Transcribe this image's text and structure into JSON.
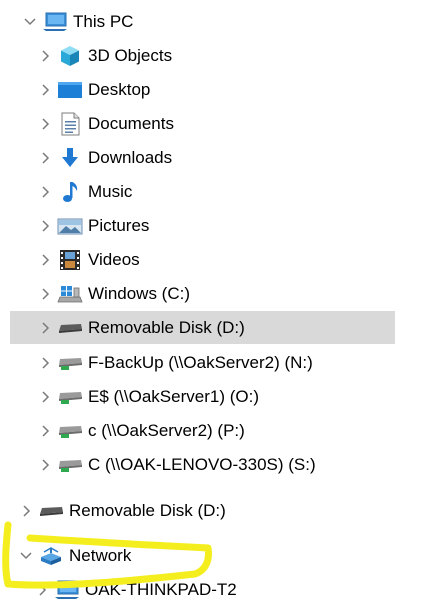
{
  "tree": {
    "this_pc": {
      "label": "This PC",
      "expanded": true,
      "icon": "this-pc-icon",
      "children": [
        {
          "label": "3D Objects",
          "icon": "3d-objects-icon"
        },
        {
          "label": "Desktop",
          "icon": "desktop-icon"
        },
        {
          "label": "Documents",
          "icon": "documents-icon"
        },
        {
          "label": "Downloads",
          "icon": "downloads-icon"
        },
        {
          "label": "Music",
          "icon": "music-icon"
        },
        {
          "label": "Pictures",
          "icon": "pictures-icon"
        },
        {
          "label": "Videos",
          "icon": "videos-icon"
        },
        {
          "label": "Windows (C:)",
          "icon": "windows-drive-icon"
        },
        {
          "label": "Removable Disk (D:)",
          "icon": "removable-disk-icon",
          "selected": true
        },
        {
          "label": "F-BackUp (\\\\OakServer2) (N:)",
          "icon": "network-drive-icon"
        },
        {
          "label": "E$ (\\\\OakServer1) (O:)",
          "icon": "network-drive-icon"
        },
        {
          "label": "c (\\\\OakServer2) (P:)",
          "icon": "network-drive-icon"
        },
        {
          "label": "C (\\\\OAK-LENOVO-330S) (S:)",
          "icon": "network-drive-icon"
        }
      ]
    },
    "removable_disk_root": {
      "label": "Removable Disk (D:)",
      "icon": "removable-disk-icon"
    },
    "network": {
      "label": "Network",
      "expanded": true,
      "icon": "network-icon",
      "children": [
        {
          "label": "OAK-THINKPAD-T2",
          "icon": "computer-icon"
        }
      ]
    }
  },
  "colors": {
    "selected_background": "#d9d9d9",
    "chevron": "#7a7a7a",
    "highlight_marker": "#f5ee1e"
  }
}
